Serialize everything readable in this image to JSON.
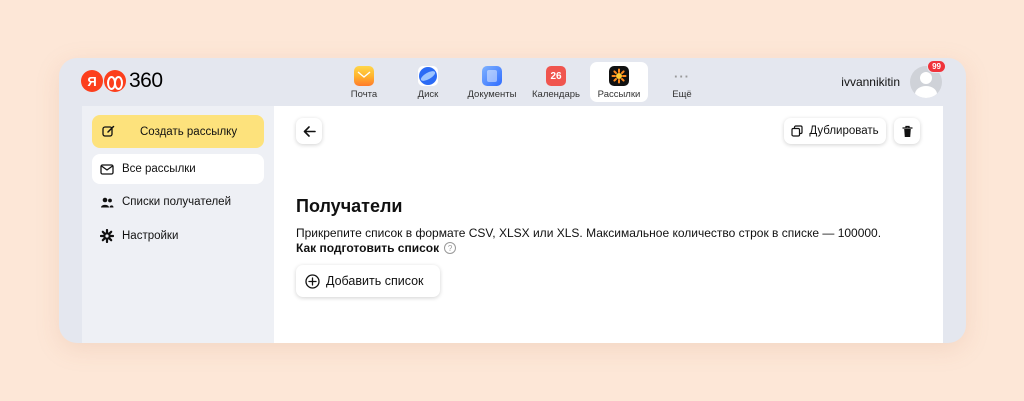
{
  "logo": {
    "ya": "Я",
    "text": "360"
  },
  "apps": [
    {
      "label": "Почта",
      "icon": "mail-icon"
    },
    {
      "label": "Диск",
      "icon": "disk-icon"
    },
    {
      "label": "Документы",
      "icon": "documents-icon"
    },
    {
      "label": "Календарь",
      "icon": "calendar-icon",
      "icon_text": "26"
    },
    {
      "label": "Рассылки",
      "icon": "mailings-icon",
      "active": true
    },
    {
      "label": "Ещё",
      "icon": "more-icon",
      "icon_text": "···"
    }
  ],
  "user": {
    "name": "ivvannikitin",
    "badge": "99"
  },
  "sidebar": {
    "create_label": "Создать рассылку",
    "items": [
      {
        "label": "Все рассылки",
        "icon": "envelope-icon",
        "active": true
      },
      {
        "label": "Списки получателей",
        "icon": "people-icon"
      },
      {
        "label": "Настройки",
        "icon": "gear-icon"
      }
    ]
  },
  "toolbar": {
    "duplicate_label": "Дублировать"
  },
  "main": {
    "title": "Получатели",
    "description": "Прикрепите список в формате CSV, XLSX или XLS. Максимальное количество строк в списке — 100000.",
    "howto_label": "Как подготовить список",
    "help_glyph": "?",
    "add_list_label": "Добавить список"
  },
  "colors": {
    "accent": "#fde27c",
    "brand": "#fc3f1d",
    "background": "#fde7d7",
    "badge": "#f0333b"
  }
}
